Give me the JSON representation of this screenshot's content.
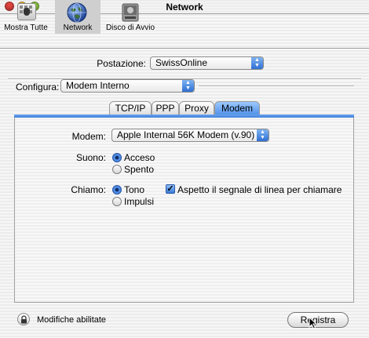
{
  "window": {
    "title": "Network"
  },
  "toolbar": {
    "items": [
      {
        "label": "Mostra Tutte",
        "icon": "apple-grid-icon"
      },
      {
        "label": "Network",
        "icon": "globe-icon"
      },
      {
        "label": "Disco di Avvio",
        "icon": "disk-icon"
      }
    ],
    "selected": "Network"
  },
  "location": {
    "label": "Postazione:",
    "value": "SwissOnline"
  },
  "configure": {
    "label": "Configura:",
    "value": "Modem Interno"
  },
  "tabs": [
    {
      "label": "TCP/IP"
    },
    {
      "label": "PPP"
    },
    {
      "label": "Proxy"
    },
    {
      "label": "Modem",
      "selected": true
    }
  ],
  "modem_tab": {
    "modem_label": "Modem:",
    "modem_value": "Apple Internal 56K Modem (v.90)",
    "sound_label": "Suono:",
    "sound_options": [
      "Acceso",
      "Spento"
    ],
    "sound_selected": "Acceso",
    "dial_label": "Chiamo:",
    "dial_options": [
      "Tono",
      "Impulsi"
    ],
    "dial_selected": "Tono",
    "wait_dialtone_label": "Aspetto il segnale di linea per chiamare",
    "wait_dialtone_checked": true
  },
  "footer": {
    "lock_text": "Modifiche abilitate",
    "save_label": "Registra"
  },
  "colors": {
    "accent": "#3d7fdb",
    "close": "#e0443e",
    "minimize": "#f0b73a",
    "zoom": "#8cc43f"
  }
}
